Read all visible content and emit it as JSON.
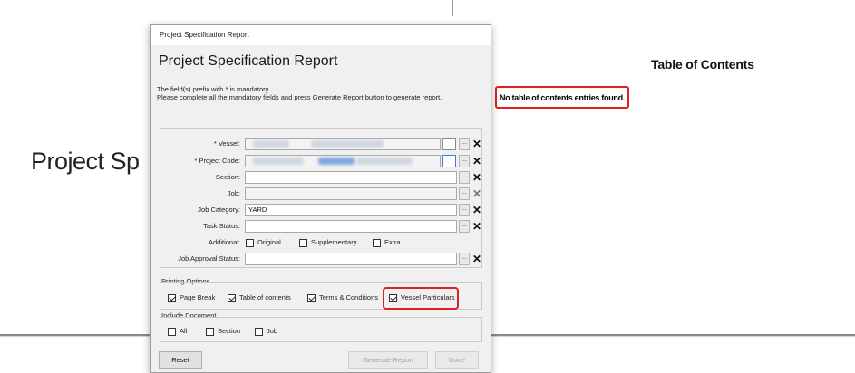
{
  "document": {
    "toc_title": "Table of Contents",
    "toc_empty_message": "No table of contents entries found.",
    "big_title": "Project Sp"
  },
  "dialog": {
    "window_title": "Project Specification Report",
    "heading": "Project Specification Report",
    "instruction_line1": "The field(s) prefix with * is mandatory.",
    "instruction_line2": "Please complete all the mandatory fields and press Generate Report button to generate report.",
    "fields": {
      "vessel": {
        "label": "* Vessel:",
        "value": ""
      },
      "project_code": {
        "label": "* Project Code:",
        "value": ""
      },
      "section": {
        "label": "Section:",
        "value": ""
      },
      "job": {
        "label": "Job:",
        "value": ""
      },
      "job_category": {
        "label": "Job Category:",
        "value": "YARD"
      },
      "task_status": {
        "label": "Task Status:",
        "value": ""
      },
      "additional": {
        "label": "Additional:"
      },
      "job_approval_status": {
        "label": "Job Approval Status:",
        "value": ""
      }
    },
    "ellipsis": "...",
    "clear_symbol": "✕",
    "additional_options": [
      {
        "label": "Original",
        "checked": false
      },
      {
        "label": "Supplementary",
        "checked": false
      },
      {
        "label": "Extra",
        "checked": false
      }
    ],
    "printing_options": {
      "title": "Printing Options",
      "items": [
        {
          "label": "Page Break",
          "checked": true
        },
        {
          "label": "Table of contents",
          "checked": true
        },
        {
          "label": "Terms & Conditions",
          "checked": true
        },
        {
          "label": "Vessel Particulars",
          "checked": true
        }
      ]
    },
    "include_document": {
      "title": "Include Document",
      "items": [
        {
          "label": "All",
          "checked": false
        },
        {
          "label": "Section",
          "checked": false
        },
        {
          "label": "Job",
          "checked": false
        }
      ]
    },
    "buttons": {
      "reset": "Reset",
      "generate": "Generate Report",
      "done": "Done"
    }
  },
  "colors": {
    "highlight": "#e02020",
    "focus": "#3b7bd4"
  }
}
